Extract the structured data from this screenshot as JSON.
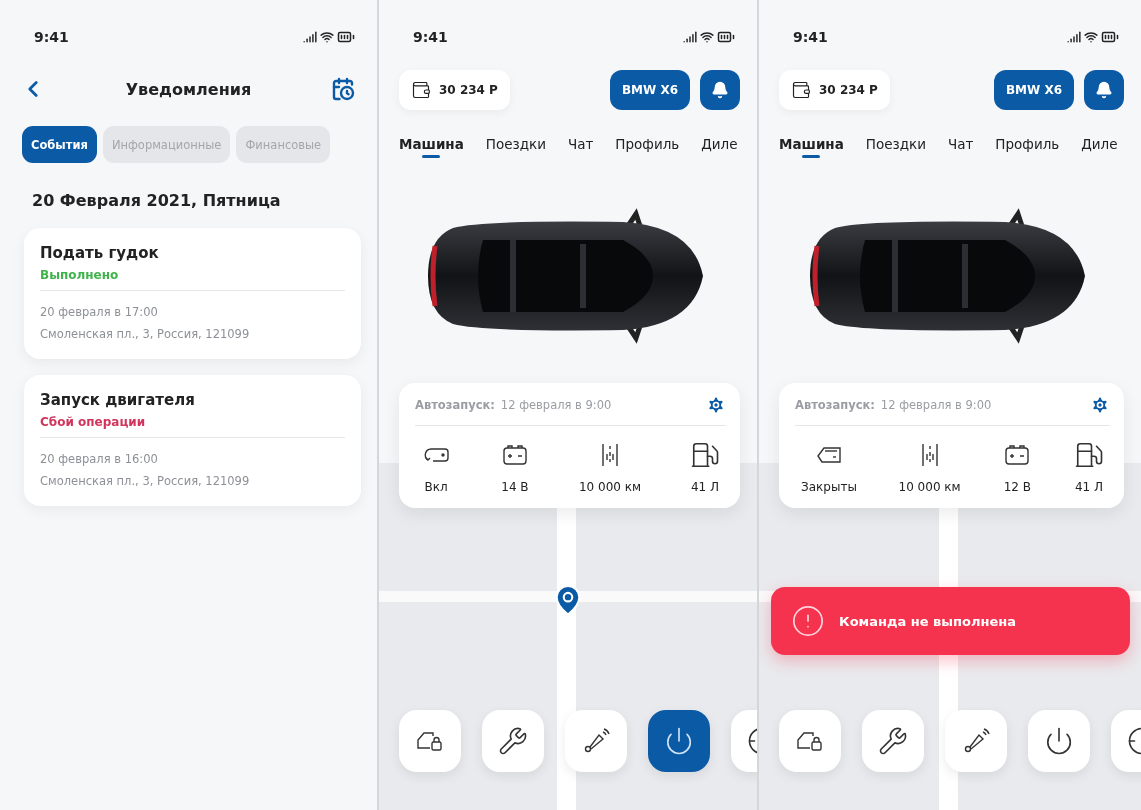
{
  "screens": [
    {
      "kind": "notifications",
      "status_time": "9:41",
      "title": "Уведомления",
      "tabs": [
        {
          "label": "События",
          "selected": true
        },
        {
          "label": "Информационные",
          "selected": false
        },
        {
          "label": "Финансовые",
          "selected": false
        }
      ],
      "date": "20 Февраля 2021, Пятница",
      "events": [
        {
          "title": "Подать гудок",
          "status": "Выполнено",
          "kind": "success",
          "time": "20 февраля в 17:00",
          "address": "Смоленская пл., 3, Россия, 121099"
        },
        {
          "title": "Запуск двигателя",
          "status": "Сбой операции",
          "kind": "error",
          "time": "20 февраля в 16:00",
          "address": "Смоленская пл., 3, Россия, 121099"
        }
      ]
    },
    {
      "kind": "car",
      "status_time": "9:41",
      "balance": "30 234 Р",
      "car_button": "BMW X6",
      "tabs": [
        {
          "label": "Машина",
          "selected": true
        },
        {
          "label": "Поездки",
          "selected": false
        },
        {
          "label": "Чат",
          "selected": false
        },
        {
          "label": "Профиль",
          "selected": false
        },
        {
          "label": "Диле",
          "selected": false
        }
      ],
      "autostart_label": "Автозапуск:",
      "autostart_value": "12 февраля в 9:00",
      "stats": [
        {
          "kind": "engine",
          "value": "Вкл"
        },
        {
          "kind": "battery",
          "value": "14 В"
        },
        {
          "kind": "mileage",
          "value": "10 000 км"
        },
        {
          "kind": "fuel",
          "value": "41 Л"
        }
      ],
      "actions": [
        {
          "kind": "lock",
          "selected": false
        },
        {
          "kind": "wrench",
          "selected": false
        },
        {
          "kind": "horn",
          "selected": false
        },
        {
          "kind": "power",
          "selected": true
        },
        {
          "kind": "target",
          "selected": false
        }
      ]
    },
    {
      "kind": "car",
      "status_time": "9:41",
      "balance": "30 234 Р",
      "car_button": "BMW X6",
      "tabs": [
        {
          "label": "Машина",
          "selected": true
        },
        {
          "label": "Поездки",
          "selected": false
        },
        {
          "label": "Чат",
          "selected": false
        },
        {
          "label": "Профиль",
          "selected": false
        },
        {
          "label": "Диле",
          "selected": false
        }
      ],
      "autostart_label": "Автозапуск:",
      "autostart_value": "12 февраля в 9:00",
      "stats": [
        {
          "kind": "door",
          "value": "Закрыты"
        },
        {
          "kind": "mileage",
          "value": "10 000 км"
        },
        {
          "kind": "battery",
          "value": "12 В"
        },
        {
          "kind": "fuel",
          "value": "41 Л"
        }
      ],
      "actions": [
        {
          "kind": "lock",
          "selected": false
        },
        {
          "kind": "wrench",
          "selected": false
        },
        {
          "kind": "horn",
          "selected": false
        },
        {
          "kind": "power",
          "selected": false
        },
        {
          "kind": "target",
          "selected": false
        }
      ],
      "toast": {
        "message": "Команда не выполнена"
      }
    }
  ]
}
